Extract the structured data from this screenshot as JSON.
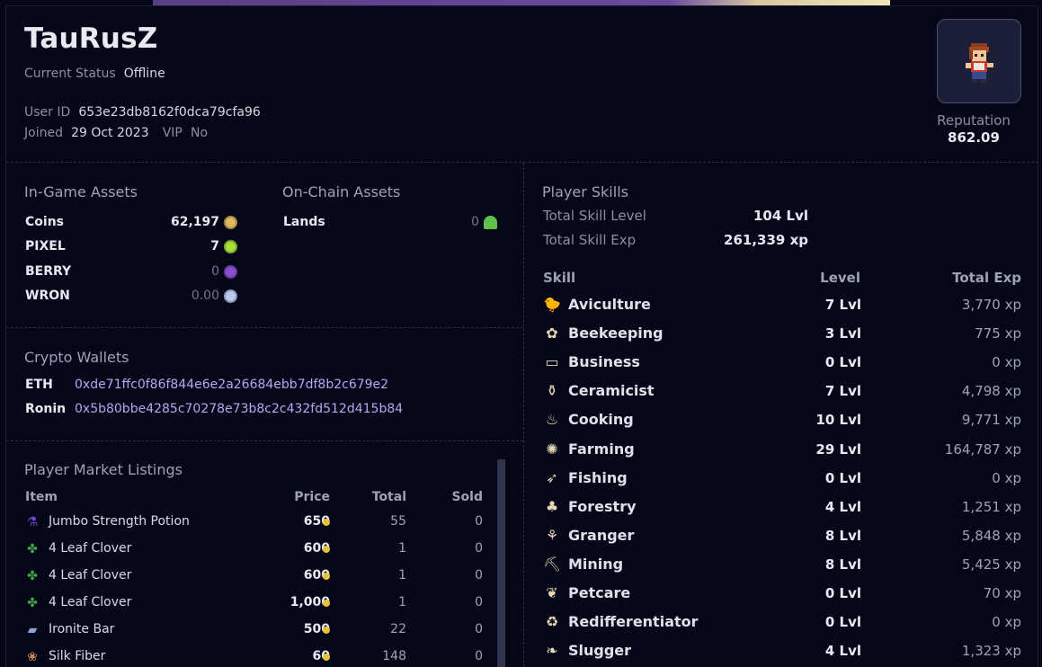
{
  "profile": {
    "username": "TauRusZ",
    "status_label": "Current Status",
    "status_value": "Offline",
    "userid_label": "User ID",
    "userid_value": "653e23db8162f0dca79cfa96",
    "joined_label": "Joined",
    "joined_value": "29 Oct 2023",
    "vip_label": "VIP",
    "vip_value": "No",
    "reputation_label": "Reputation",
    "reputation_value": "862.09"
  },
  "in_game_assets": {
    "title": "In-Game Assets",
    "items": [
      {
        "name": "Coins",
        "value": "62,197",
        "icon": "coin-icon",
        "color": "#e1b760",
        "dim": false
      },
      {
        "name": "PIXEL",
        "value": "7",
        "icon": "pixel-gem-icon",
        "color": "#a8e03a",
        "dim": false
      },
      {
        "name": "BERRY",
        "value": "0",
        "icon": "berry-icon",
        "color": "#8b4fd1",
        "dim": true
      },
      {
        "name": "WRON",
        "value": "0.00",
        "icon": "ronin-icon",
        "color": "#b9c8ef",
        "dim": true
      }
    ]
  },
  "on_chain_assets": {
    "title": "On-Chain Assets",
    "items": [
      {
        "name": "Lands",
        "value": "0",
        "icon": "land-tree-icon",
        "color": "#5fc04a",
        "dim": true
      }
    ]
  },
  "wallets": {
    "title": "Crypto Wallets",
    "items": [
      {
        "chain": "ETH",
        "address": "0xde71ffc0f86f844e6e2a26684ebb7df8b2c679e2"
      },
      {
        "chain": "Ronin",
        "address": "0x5b80bbe4285c70278e73b8c2c432fd512d415b84"
      }
    ]
  },
  "market": {
    "title": "Player Market Listings",
    "headers": {
      "item": "Item",
      "price": "Price",
      "total": "Total",
      "sold": "Sold"
    },
    "rows": [
      {
        "icon": "potion-icon",
        "glyph": "⚗",
        "color": "#7a45c9",
        "name": "Jumbo Strength Potion",
        "price": "650",
        "total": "55",
        "sold": "0"
      },
      {
        "icon": "clover-icon",
        "glyph": "✤",
        "color": "#3fa84b",
        "name": "4 Leaf Clover",
        "price": "600",
        "total": "1",
        "sold": "0"
      },
      {
        "icon": "clover-icon",
        "glyph": "✤",
        "color": "#3fa84b",
        "name": "4 Leaf Clover",
        "price": "600",
        "total": "1",
        "sold": "0"
      },
      {
        "icon": "clover-icon",
        "glyph": "✤",
        "color": "#3fa84b",
        "name": "4 Leaf Clover",
        "price": "1,000",
        "total": "1",
        "sold": "0"
      },
      {
        "icon": "ironite-bar-icon",
        "glyph": "▰",
        "color": "#8aa4dc",
        "name": "Ironite Bar",
        "price": "500",
        "total": "22",
        "sold": "0"
      },
      {
        "icon": "silk-fiber-icon",
        "glyph": "❀",
        "color": "#c98a55",
        "name": "Silk Fiber",
        "price": "60",
        "total": "148",
        "sold": "0"
      }
    ]
  },
  "skills": {
    "title": "Player Skills",
    "total_level_label": "Total Skill Level",
    "total_level_value": "104 Lvl",
    "total_exp_label": "Total Skill Exp",
    "total_exp_value": "261,339 xp",
    "headers": {
      "skill": "Skill",
      "level": "Level",
      "exp": "Total Exp"
    },
    "rows": [
      {
        "icon": "aviculture-icon",
        "glyph": "🐤",
        "name": "Aviculture",
        "level": "7 Lvl",
        "exp": "3,770 xp"
      },
      {
        "icon": "beekeeping-icon",
        "glyph": "✿",
        "name": "Beekeeping",
        "level": "3 Lvl",
        "exp": "775 xp"
      },
      {
        "icon": "business-icon",
        "glyph": "▭",
        "name": "Business",
        "level": "0 Lvl",
        "exp": "0 xp"
      },
      {
        "icon": "ceramicist-icon",
        "glyph": "⚱",
        "name": "Ceramicist",
        "level": "7 Lvl",
        "exp": "4,798 xp"
      },
      {
        "icon": "cooking-icon",
        "glyph": "♨",
        "name": "Cooking",
        "level": "10 Lvl",
        "exp": "9,771 xp"
      },
      {
        "icon": "farming-icon",
        "glyph": "✺",
        "name": "Farming",
        "level": "29 Lvl",
        "exp": "164,787 xp"
      },
      {
        "icon": "fishing-icon",
        "glyph": "➶",
        "name": "Fishing",
        "level": "0 Lvl",
        "exp": "0 xp"
      },
      {
        "icon": "forestry-icon",
        "glyph": "♣",
        "name": "Forestry",
        "level": "4 Lvl",
        "exp": "1,251 xp"
      },
      {
        "icon": "granger-icon",
        "glyph": "⚘",
        "name": "Granger",
        "level": "8 Lvl",
        "exp": "5,848 xp"
      },
      {
        "icon": "mining-icon",
        "glyph": "⛏",
        "name": "Mining",
        "level": "8 Lvl",
        "exp": "5,425 xp"
      },
      {
        "icon": "petcare-icon",
        "glyph": "❦",
        "name": "Petcare",
        "level": "0 Lvl",
        "exp": "70 xp"
      },
      {
        "icon": "redifferentiator-icon",
        "glyph": "♻",
        "name": "Redifferentiator",
        "level": "0 Lvl",
        "exp": "0 xp"
      },
      {
        "icon": "slugger-icon",
        "glyph": "❧",
        "name": "Slugger",
        "level": "4 Lvl",
        "exp": "1,323 xp"
      }
    ]
  }
}
